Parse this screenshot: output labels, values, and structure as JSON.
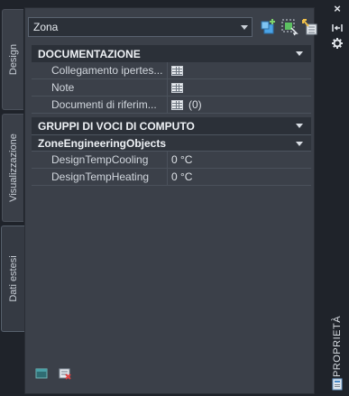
{
  "left_tabs": [
    {
      "label": "Design"
    },
    {
      "label": "Visualizzazione"
    },
    {
      "label": "Dati estesi"
    }
  ],
  "selector": {
    "value": "Zona"
  },
  "toolbar": {
    "icons": [
      "add-object-icon",
      "select-objects-icon",
      "quick-select-icon"
    ]
  },
  "sections": {
    "documentazione": {
      "title": "DOCUMENTAZIONE",
      "rows": [
        {
          "label": "Collegamento ipertes...",
          "value": ""
        },
        {
          "label": "Note",
          "value": ""
        },
        {
          "label": "Documenti di riferim...",
          "value": "(0)"
        }
      ]
    },
    "gruppi": {
      "title": "GRUPPI DI VOCI DI COMPUTO",
      "subsection": "ZoneEngineeringObjects",
      "rows": [
        {
          "label": "DesignTempCooling",
          "value": "0 °C"
        },
        {
          "label": "DesignTempHeating",
          "value": "0 °C"
        }
      ]
    }
  },
  "bottom": {
    "icons": [
      "add-property-set-icon",
      "remove-property-set-icon"
    ]
  },
  "right_strip": {
    "close": "×",
    "label": "PROPRIETÀ"
  }
}
